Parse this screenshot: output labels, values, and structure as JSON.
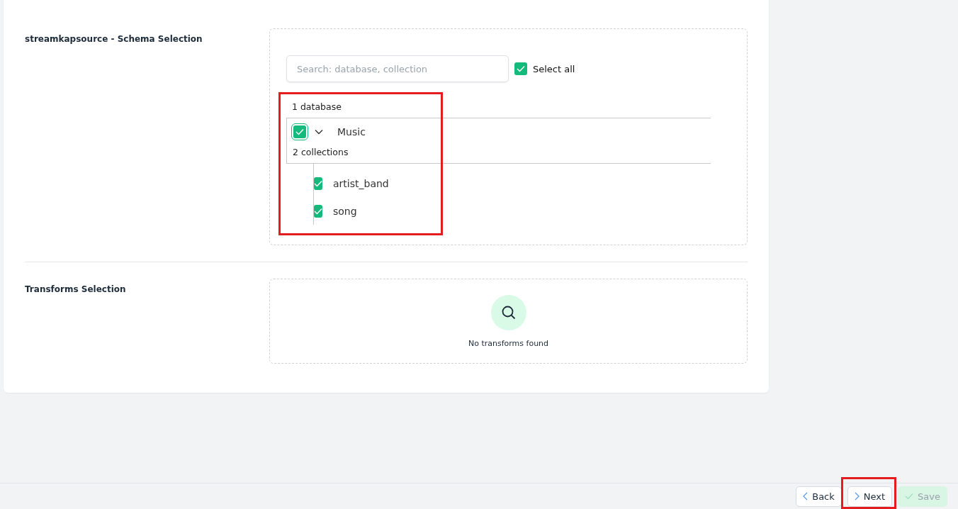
{
  "schema_section": {
    "title": "streamkapsource - Schema Selection",
    "search": {
      "placeholder": "Search: database, collection"
    },
    "select_all": {
      "label": "Select all",
      "checked": true
    },
    "tree": {
      "highlighted": true,
      "count_label": "1 database",
      "databases": [
        {
          "name": "Music",
          "checked": true,
          "expanded": true,
          "count_label": "2 collections",
          "children": [
            {
              "name": "artist_band",
              "checked": true
            },
            {
              "name": "song",
              "checked": true
            }
          ]
        }
      ]
    }
  },
  "transforms_section": {
    "title": "Transforms Selection",
    "empty_text": "No transforms found"
  },
  "footer": {
    "buttons": [
      {
        "kind": "back",
        "label": "Back",
        "disabled": false,
        "highlighted": false
      },
      {
        "kind": "next",
        "label": "Next",
        "disabled": false,
        "highlighted": true
      },
      {
        "kind": "save",
        "label": "Save",
        "disabled": true,
        "highlighted": false
      }
    ]
  }
}
